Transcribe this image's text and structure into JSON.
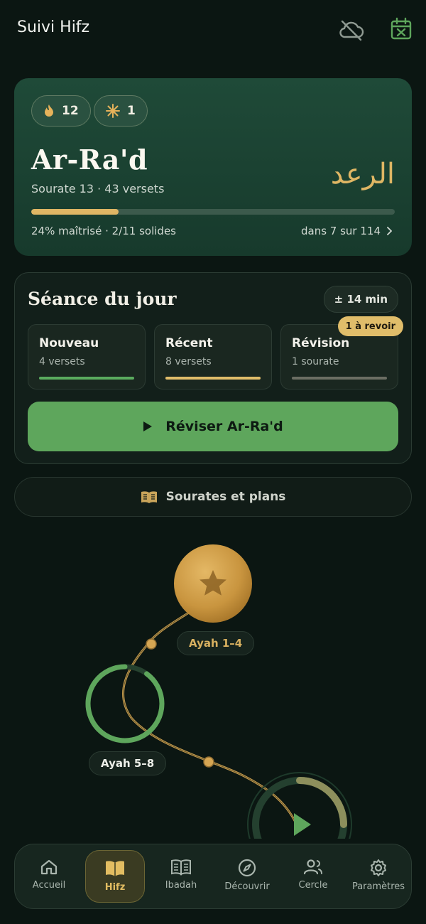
{
  "header": {
    "title": "Suivi Hifz",
    "icons": [
      "cloud-off-icon",
      "calendar-x-icon"
    ]
  },
  "hero": {
    "streak_count": "12",
    "freeze_count": "1",
    "surah_name": "Ar-Ra'd",
    "surah_arabic": "الرعد",
    "subtitle": "Sourate 13 · 43 versets",
    "progress": 0.24,
    "stats": "24% maîtrisé · 2/11 solides",
    "rank": "dans 7 sur 114"
  },
  "session": {
    "title": "Séance du jour",
    "duration": "± 14 min",
    "tiles": [
      {
        "title": "Nouveau",
        "sub": "4 versets",
        "color": "#5aab5e"
      },
      {
        "title": "Récent",
        "sub": "8 versets",
        "color": "#e0bd6a"
      },
      {
        "title": "Révision",
        "sub": "1 sourate",
        "color": "#6b6e63",
        "badge": "1 à revoir"
      }
    ],
    "cta_label": "Réviser Ar-Ra'd"
  },
  "sourates_button": "Sourates et plans",
  "path": {
    "node1_label": "Ayah 1–4",
    "node2_label": "Ayah 5–8",
    "node2_progress": 0.9
  },
  "nav": {
    "items": [
      {
        "label": "Accueil",
        "icon": "home-icon"
      },
      {
        "label": "Hifz",
        "icon": "book-open-icon",
        "active": true
      },
      {
        "label": "Ibadah",
        "icon": "book-icon"
      },
      {
        "label": "Découvrir",
        "icon": "compass-icon"
      },
      {
        "label": "Cercle",
        "icon": "people-icon"
      },
      {
        "label": "Paramètres",
        "icon": "gear-icon"
      }
    ]
  },
  "colors": {
    "accent_gold": "#dfb664",
    "accent_green": "#5ea65c",
    "background": "#0b1612"
  }
}
